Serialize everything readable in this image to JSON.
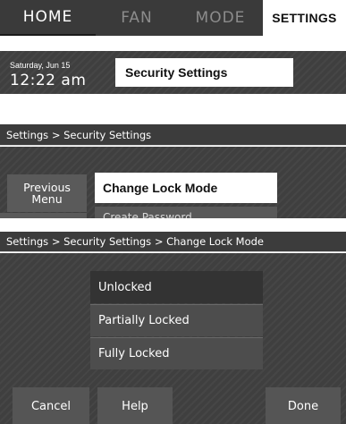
{
  "nav": {
    "tabs": [
      {
        "label": "HOME"
      },
      {
        "label": "FAN"
      },
      {
        "label": "MODE"
      },
      {
        "label": "SETTINGS"
      }
    ],
    "active_tab": "SETTINGS"
  },
  "status": {
    "date": "Saturday, Jun 15",
    "time": "12:22 am",
    "title": "Security Settings"
  },
  "security_menu": {
    "breadcrumb": "Settings > Security Settings",
    "previous_menu_label": "Previous Menu",
    "items": [
      {
        "label": "Change Lock Mode",
        "selected": true
      },
      {
        "label": "Create Password"
      }
    ]
  },
  "lock_mode": {
    "breadcrumb": "Settings > Security Settings > Change Lock Mode",
    "options": [
      {
        "label": "Unlocked",
        "selected": true
      },
      {
        "label": "Partially Locked"
      },
      {
        "label": "Fully Locked"
      }
    ],
    "buttons": {
      "cancel": "Cancel",
      "help": "Help",
      "done": "Done"
    }
  },
  "colors": {
    "panel_background": "#3f3f3f",
    "button_gray": "#555555",
    "selected_white": "#ffffff",
    "inactive_tab_text": "#8c8c8c"
  }
}
